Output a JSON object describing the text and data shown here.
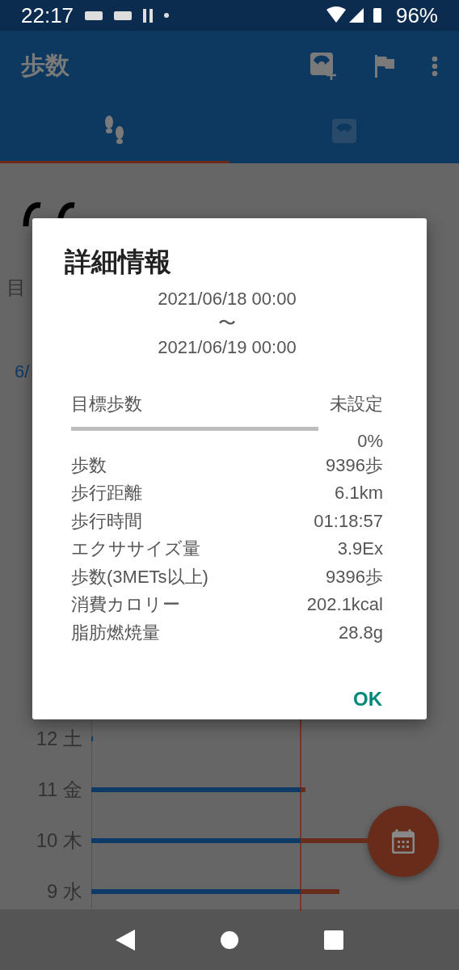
{
  "status_bar": {
    "time": "22:17",
    "battery": "96%"
  },
  "app_bar": {
    "title": "歩数"
  },
  "tabs": [
    {
      "selected": true
    },
    {
      "selected": false
    }
  ],
  "background": {
    "goal_label": "目",
    "date_label": "6/"
  },
  "dialog": {
    "title": "詳細情報",
    "period_start": "2021/06/18 00:00",
    "period_separator": "〜",
    "period_end": "2021/06/19 00:00",
    "goal": {
      "label": "目標歩数",
      "value": "未設定",
      "level": 0,
      "percent": "0%"
    },
    "rows": [
      {
        "label": "歩数",
        "value": "9396歩"
      },
      {
        "label": "歩行距離",
        "value": "6.1km"
      },
      {
        "label": "歩行時間",
        "value": "01:18:57"
      },
      {
        "label": "エクササイズ量",
        "value": "3.9Ex"
      },
      {
        "label": "歩数(3METs以上)",
        "value": "9396歩"
      },
      {
        "label": "消費カロリー",
        "value": "202.1kcal"
      },
      {
        "label": "脂肪燃焼量",
        "value": "28.8g"
      }
    ],
    "ok": "OK"
  },
  "days": [
    {
      "label": "12 土"
    },
    {
      "label": "11 金"
    },
    {
      "label": "10 木"
    },
    {
      "label": "9 水"
    }
  ]
}
